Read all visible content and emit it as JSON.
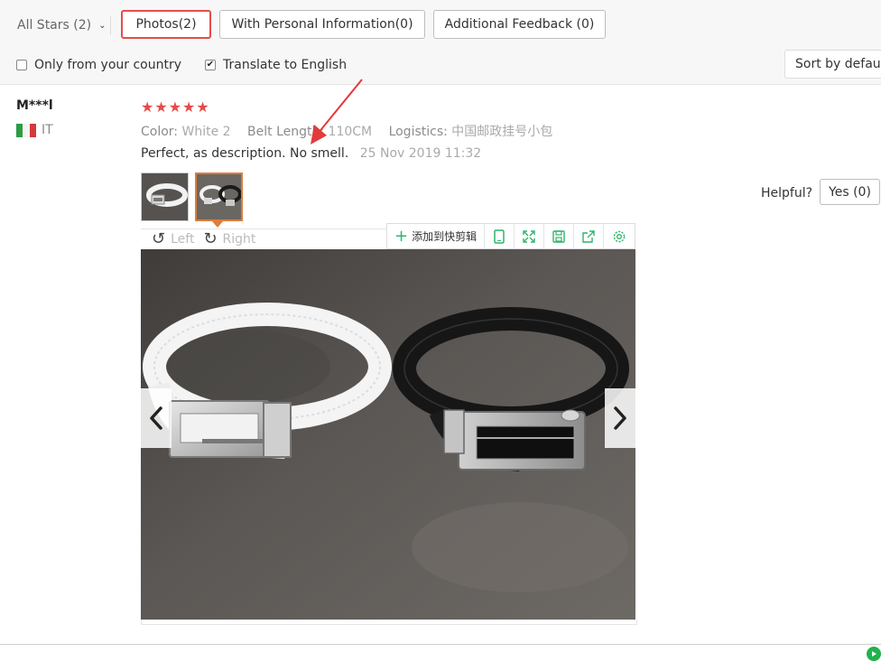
{
  "filters": {
    "all_stars": "All Stars (2)",
    "tabs": [
      {
        "label": "Photos(2)",
        "active": true
      },
      {
        "label": "With Personal Information(0)",
        "active": false
      },
      {
        "label": "Additional Feedback (0)",
        "active": false
      }
    ],
    "only_country": {
      "label": "Only from your country",
      "checked": false
    },
    "translate": {
      "label": "Translate to English",
      "checked": true
    },
    "sort": "Sort by default"
  },
  "review": {
    "user": "M***l",
    "country": "IT",
    "rating": 5,
    "attributes": [
      {
        "key": "Color:",
        "value": "White 2"
      },
      {
        "key": "Belt Length:",
        "value": "110CM"
      },
      {
        "key": "Logistics:",
        "value": "中国邮政挂号小包"
      }
    ],
    "text": "Perfect, as description. No smell.",
    "date": "25 Nov 2019 11:32",
    "thumbnails": [
      {
        "icon": "white-belt-photo-thumbnail"
      },
      {
        "icon": "two-belts-photo-thumbnail",
        "selected": true
      }
    ],
    "helpful_label": "Helpful?",
    "yes_label": "Yes (0)"
  },
  "viewer": {
    "rotate_left": "Left",
    "rotate_right": "Right",
    "toolbar_add": "添加到快剪辑",
    "toolbar_icons": [
      "phone-icon",
      "fullscreen-icon",
      "save-icon",
      "share-icon",
      "settings-icon"
    ]
  },
  "colors": {
    "accent_red": "#e44d4d",
    "star_red": "#e84a4a",
    "selected_orange": "#e07b39",
    "toolbar_green": "#2fb36b",
    "annotation_red": "#e23b3b"
  }
}
